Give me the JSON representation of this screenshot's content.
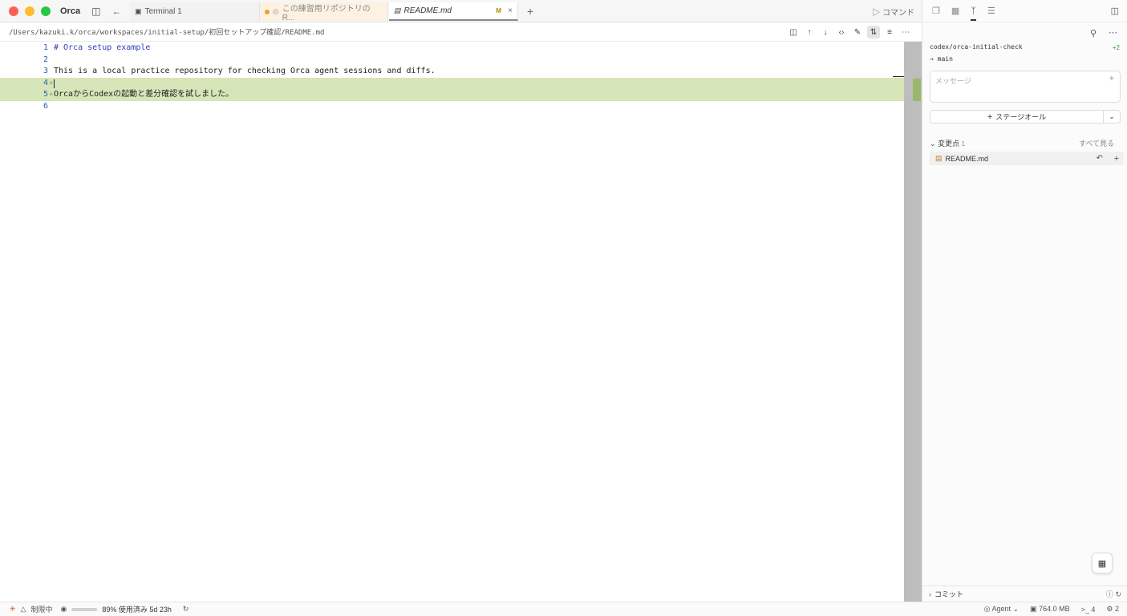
{
  "app": {
    "name": "Orca"
  },
  "tabs": [
    {
      "label": "Terminal 1"
    },
    {
      "label": "この練習用リポジトリの R..."
    },
    {
      "label": "README.md",
      "modified_badge": "M",
      "close": "×"
    }
  ],
  "toolbar": {
    "command_label": "コマンド",
    "new_tab": "+"
  },
  "path": "/Users/kazuki.k/orca/workspaces/initial-setup/初回セットアップ確認/README.md",
  "editor": {
    "lines": [
      {
        "num": "1",
        "marker": "",
        "text": "# Orca setup example"
      },
      {
        "num": "2",
        "marker": "",
        "text": ""
      },
      {
        "num": "3",
        "marker": "",
        "text": "This is a local practice repository for checking Orca agent sessions and diffs."
      },
      {
        "num": "4",
        "marker": "+",
        "text": ""
      },
      {
        "num": "5",
        "marker": "+",
        "text": "OrcaからCodexの起動と差分確認を試しました。"
      },
      {
        "num": "6",
        "marker": "",
        "text": ""
      }
    ]
  },
  "source_control": {
    "branch": "codex/orca-initial-check",
    "ahead": "+2",
    "base": "main",
    "message_placeholder": "メッセージ",
    "stage_all_label": "ステージオール",
    "changes_label": "変更点",
    "changes_count": "1",
    "see_all_label": "すべて見る",
    "files": [
      {
        "name": "README.md"
      }
    ],
    "commit_label": "コミット"
  },
  "status": {
    "limit_label": "制限中",
    "usage_text": "89% 使用済み 5d 23h",
    "agent_label": "Agent",
    "memory": "764.0 MB",
    "terminals": "4",
    "ports": "2"
  },
  "colors": {
    "added_line": "#d6e6b8",
    "overview_added": "#9ab86a",
    "accent": "#2f3db5"
  }
}
